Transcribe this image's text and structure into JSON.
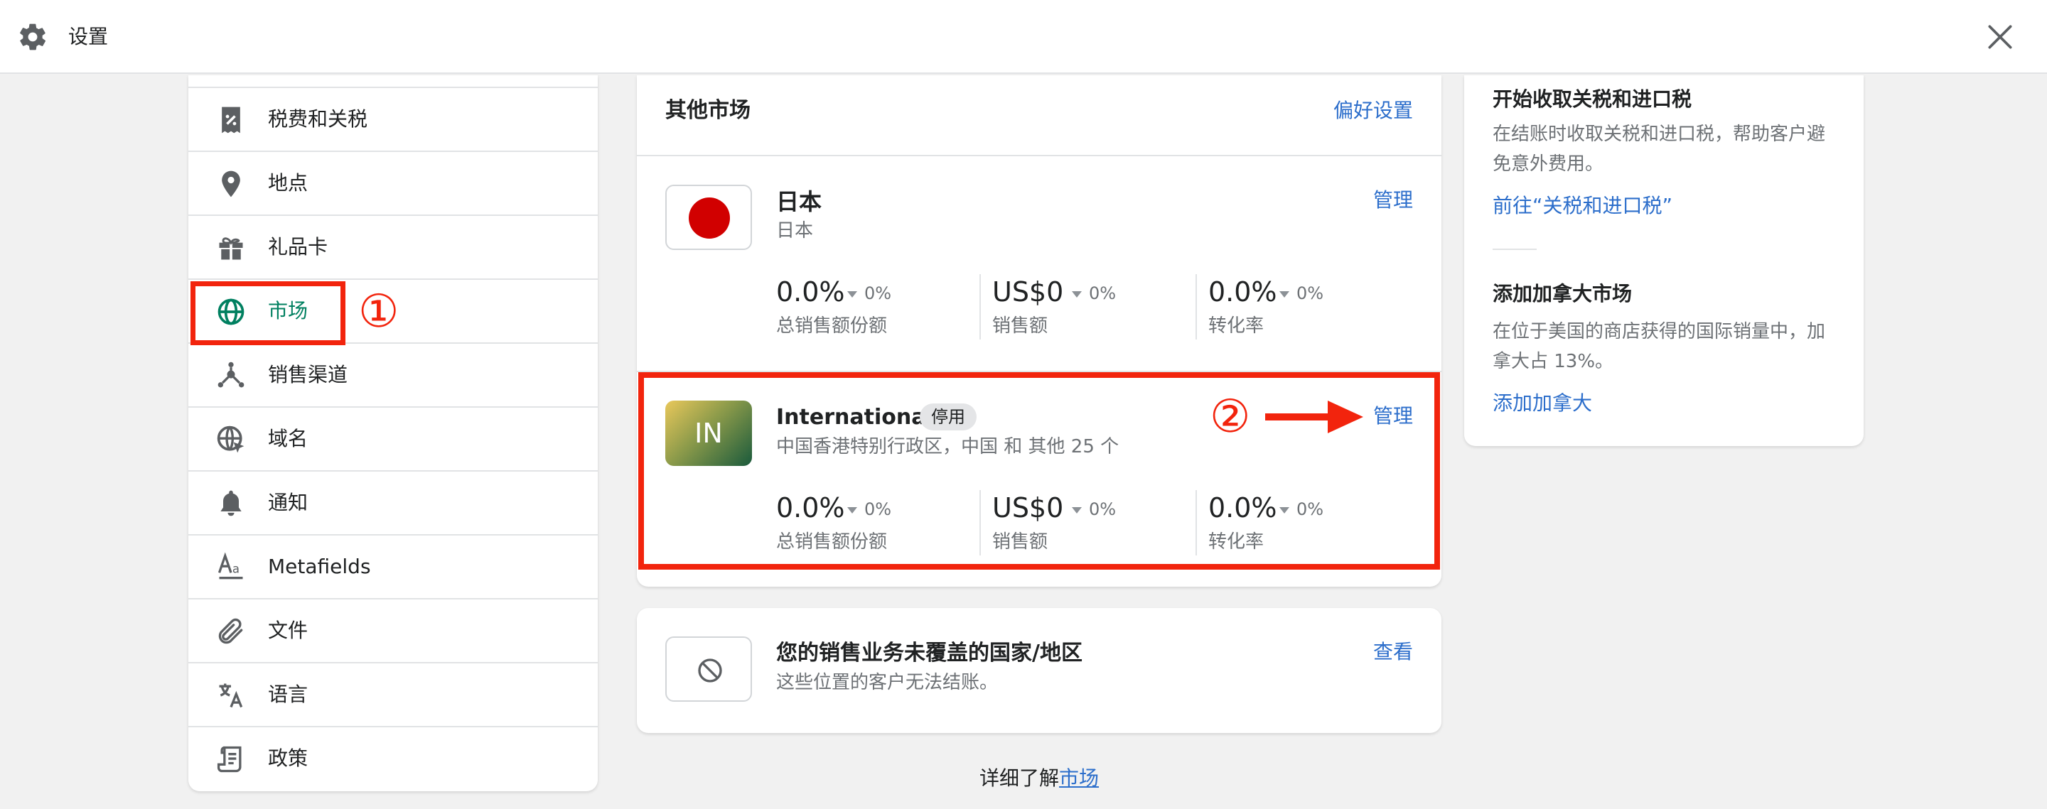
{
  "header": {
    "title": "设置",
    "settings_icon": "gear-icon",
    "close_icon": "close-icon"
  },
  "sidebar": {
    "items": [
      {
        "label": "税费和关税",
        "icon": "receipt-percent-icon"
      },
      {
        "label": "地点",
        "icon": "location-pin-icon"
      },
      {
        "label": "礼品卡",
        "icon": "gift-icon"
      },
      {
        "label": "市场",
        "icon": "globe-icon",
        "active": true
      },
      {
        "label": "销售渠道",
        "icon": "channels-icon"
      },
      {
        "label": "域名",
        "icon": "domain-globe-icon"
      },
      {
        "label": "通知",
        "icon": "bell-icon"
      },
      {
        "label": "Metafields",
        "icon": "metafields-icon"
      },
      {
        "label": "文件",
        "icon": "paperclip-icon"
      },
      {
        "label": "语言",
        "icon": "translate-icon"
      },
      {
        "label": "政策",
        "icon": "policy-scroll-icon"
      }
    ],
    "active_color": "#008060"
  },
  "annotations": {
    "step1": "①",
    "step2": "②",
    "color": "#f2240d"
  },
  "other_markets": {
    "title": "其他市场",
    "preferences_link": "偏好设置",
    "markets": [
      {
        "name": "日本",
        "subtitle": "日本",
        "manage": "管理",
        "metrics": [
          {
            "value": "0.0%",
            "change": "0%",
            "label": "总销售额份额"
          },
          {
            "value": "US$0",
            "change": "0%",
            "label": "销售额"
          },
          {
            "value": "0.0%",
            "change": "0%",
            "label": "转化率"
          }
        ]
      },
      {
        "name": "International",
        "badge": "停用",
        "initials": "IN",
        "subtitle": "中国香港特别行政区，中国 和 其他 25 个",
        "manage": "管理",
        "metrics": [
          {
            "value": "0.0%",
            "change": "0%",
            "label": "总销售额份额"
          },
          {
            "value": "US$0",
            "change": "0%",
            "label": "销售额"
          },
          {
            "value": "0.0%",
            "change": "0%",
            "label": "转化率"
          }
        ]
      }
    ]
  },
  "uncovered": {
    "title": "您的销售业务未覆盖的国家/地区",
    "subtitle": "这些位置的客户无法结账。",
    "view_link": "查看",
    "icon": "prohibited-icon"
  },
  "footer": {
    "prefix": "详细了解",
    "link": "市场"
  },
  "right_panel": {
    "duties": {
      "title": "开始收取关税和进口税",
      "body": "在结账时收取关税和进口税，帮助客户避免意外费用。",
      "link": "前往“关税和进口税”"
    },
    "canada": {
      "title": "添加加拿大市场",
      "body": "在位于美国的商店获得的国际销量中，加拿大占 13%。",
      "link": "添加加拿大"
    }
  },
  "colors": {
    "link": "#2c6ecb",
    "annotation_red": "#f2240d",
    "japan_red": "#d10000"
  }
}
